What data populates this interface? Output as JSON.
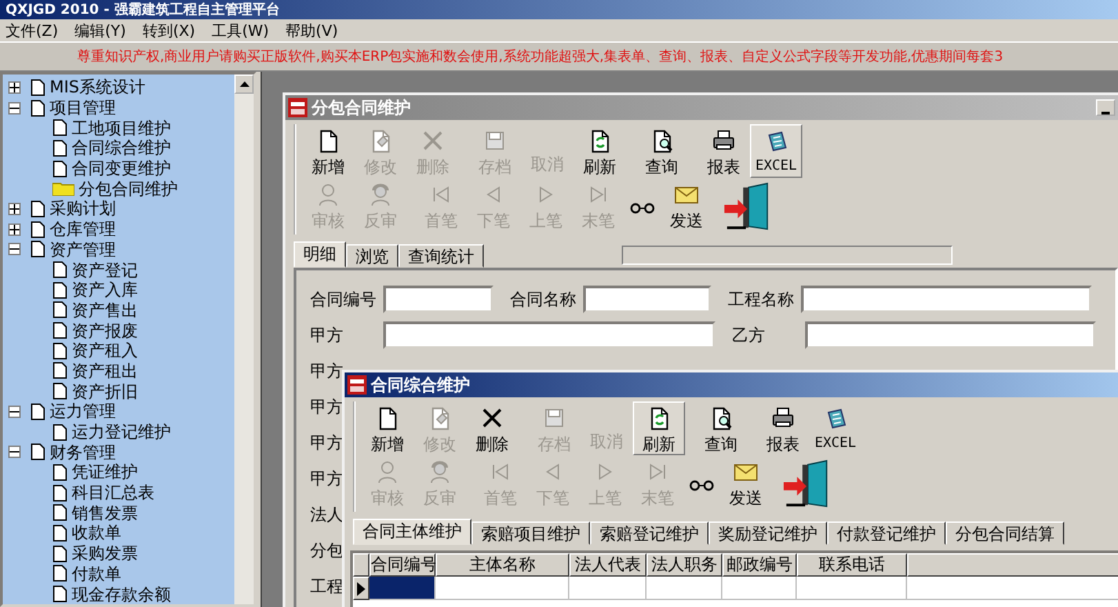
{
  "app_title": "QXJGD 2010 - 强霸建筑工程自主管理平台",
  "menu": [
    "文件(Z)",
    "编辑(Y)",
    "转到(X)",
    "工具(W)",
    "帮助(V)"
  ],
  "notice": "尊重知识产权,商业用户请购买正版软件,购买本ERP包实施和数会使用,系统功能超强大,集表单、查询、报表、自定义公式字段等开发功能,优惠期间每套3",
  "tree": [
    {
      "label": "MIS系统设计",
      "expanded": false,
      "selected": false
    },
    {
      "label": "项目管理",
      "expanded": true,
      "selected": false,
      "children": [
        {
          "label": "工地项目维护",
          "selected": false
        },
        {
          "label": "合同综合维护",
          "selected": false
        },
        {
          "label": "合同变更维护",
          "selected": false
        },
        {
          "label": "分包合同维护",
          "selected": true
        }
      ]
    },
    {
      "label": "采购计划",
      "expanded": false,
      "selected": false
    },
    {
      "label": "仓库管理",
      "expanded": false,
      "selected": false
    },
    {
      "label": "资产管理",
      "expanded": true,
      "selected": false,
      "children": [
        {
          "label": "资产登记",
          "selected": false
        },
        {
          "label": "资产入库",
          "selected": false
        },
        {
          "label": "资产售出",
          "selected": false
        },
        {
          "label": "资产报废",
          "selected": false
        },
        {
          "label": "资产租入",
          "selected": false
        },
        {
          "label": "资产租出",
          "selected": false
        },
        {
          "label": "资产折旧",
          "selected": false
        }
      ]
    },
    {
      "label": "运力管理",
      "expanded": true,
      "selected": false,
      "children": [
        {
          "label": "运力登记维护",
          "selected": false
        }
      ]
    },
    {
      "label": "财务管理",
      "expanded": true,
      "selected": false,
      "children": [
        {
          "label": "凭证维护",
          "selected": false
        },
        {
          "label": "科目汇总表",
          "selected": false
        },
        {
          "label": "销售发票",
          "selected": false
        },
        {
          "label": "收款单",
          "selected": false
        },
        {
          "label": "采购发票",
          "selected": false
        },
        {
          "label": "付款单",
          "selected": false
        },
        {
          "label": "现金存款余额",
          "selected": false
        }
      ]
    }
  ],
  "windows": [
    {
      "title": "分包合同维护",
      "active": false,
      "toolbar": [
        [
          {
            "kind": "new",
            "label": "新增",
            "disabled": false,
            "pressed": false
          },
          {
            "kind": "edit",
            "label": "修改",
            "disabled": true,
            "pressed": false
          },
          {
            "kind": "delete",
            "label": "删除",
            "disabled": true,
            "pressed": false
          },
          {
            "kind": "save",
            "label": "存档",
            "disabled": true,
            "pressed": false
          },
          {
            "kind": "cancel",
            "label": "取消",
            "disabled": true,
            "pressed": false
          },
          {
            "kind": "refresh",
            "label": "刷新",
            "disabled": false,
            "pressed": false
          },
          {
            "kind": "query",
            "label": "查询",
            "disabled": false,
            "pressed": false
          },
          {
            "kind": "report",
            "label": "报表",
            "disabled": false,
            "pressed": false
          },
          {
            "kind": "excel",
            "label": "EXCEL",
            "disabled": false,
            "pressed": true
          }
        ],
        [
          {
            "kind": "audit",
            "label": "审核",
            "disabled": true,
            "pressed": false
          },
          {
            "kind": "unaudit",
            "label": "反审",
            "disabled": true,
            "pressed": false
          },
          {
            "kind": "first",
            "label": "首笔",
            "disabled": true,
            "pressed": false
          },
          {
            "kind": "prev",
            "label": "下笔",
            "disabled": true,
            "pressed": false
          },
          {
            "kind": "next",
            "label": "上笔",
            "disabled": true,
            "pressed": false
          },
          {
            "kind": "last",
            "label": "末笔",
            "disabled": true,
            "pressed": false
          },
          {
            "kind": "glasses",
            "disabled": false,
            "pressed": false
          },
          {
            "kind": "send",
            "label": "发送",
            "disabled": false,
            "pressed": false
          },
          {
            "kind": "exit",
            "disabled": false,
            "pressed": false
          }
        ]
      ],
      "tabs": [
        {
          "label": "明细",
          "selected": true
        },
        {
          "label": "浏览",
          "selected": false
        },
        {
          "label": "查询统计",
          "selected": false
        }
      ],
      "form": [
        [
          {
            "kind": "field",
            "label": "合同编号"
          },
          {
            "kind": "field",
            "label": "合同名称"
          },
          {
            "kind": "field",
            "label": "工程名称"
          }
        ],
        [
          {
            "kind": "field",
            "label": "甲方"
          },
          {
            "kind": "field",
            "label": "乙方"
          }
        ],
        [
          {
            "kind": "label",
            "label": "甲方"
          }
        ],
        [
          {
            "kind": "label",
            "label": "甲方"
          }
        ],
        [
          {
            "kind": "label",
            "label": "甲方"
          }
        ],
        [
          {
            "kind": "label",
            "label": "甲方"
          }
        ],
        [
          {
            "kind": "label",
            "label": "法人"
          }
        ],
        [
          {
            "kind": "label",
            "label": "分包"
          }
        ],
        [
          {
            "kind": "label",
            "label": "工程"
          }
        ]
      ]
    },
    {
      "title": "合同综合维护",
      "active": true,
      "toolbar": [
        [
          {
            "kind": "new",
            "label": "新增",
            "disabled": false,
            "pressed": false
          },
          {
            "kind": "edit",
            "label": "修改",
            "disabled": true,
            "pressed": false
          },
          {
            "kind": "delete",
            "label": "删除",
            "disabled": false,
            "pressed": false
          },
          {
            "kind": "save",
            "label": "存档",
            "disabled": true,
            "pressed": false
          },
          {
            "kind": "cancel",
            "label": "取消",
            "disabled": true,
            "pressed": false
          },
          {
            "kind": "refresh",
            "label": "刷新",
            "disabled": false,
            "pressed": true
          },
          {
            "kind": "query",
            "label": "查询",
            "disabled": false,
            "pressed": false
          },
          {
            "kind": "report",
            "label": "报表",
            "disabled": false,
            "pressed": false
          },
          {
            "kind": "excel",
            "label": "EXCEL",
            "disabled": false,
            "pressed": false
          }
        ],
        [
          {
            "kind": "audit",
            "label": "审核",
            "disabled": true,
            "pressed": false
          },
          {
            "kind": "unaudit",
            "label": "反审",
            "disabled": true,
            "pressed": false
          },
          {
            "kind": "first",
            "label": "首笔",
            "disabled": true,
            "pressed": false
          },
          {
            "kind": "prev",
            "label": "下笔",
            "disabled": true,
            "pressed": false
          },
          {
            "kind": "next",
            "label": "上笔",
            "disabled": true,
            "pressed": false
          },
          {
            "kind": "last",
            "label": "末笔",
            "disabled": true,
            "pressed": false
          },
          {
            "kind": "glasses",
            "disabled": false,
            "pressed": false
          },
          {
            "kind": "send",
            "label": "发送",
            "disabled": false,
            "pressed": false
          },
          {
            "kind": "exit",
            "disabled": false,
            "pressed": false
          }
        ]
      ],
      "tabs": [
        {
          "label": "合同主体维护",
          "selected": true
        },
        {
          "label": "索赔项目维护",
          "selected": false
        },
        {
          "label": "索赔登记维护",
          "selected": false
        },
        {
          "label": "奖励登记维护",
          "selected": false
        },
        {
          "label": "付款登记维护",
          "selected": false
        },
        {
          "label": "分包合同结算",
          "selected": false
        }
      ],
      "grid": {
        "columns": [
          "合同编号",
          "主体名称",
          "法人代表",
          "法人职务",
          "邮政编号",
          "联系电话"
        ],
        "rows": [
          {
            "selected": true
          }
        ]
      }
    }
  ]
}
